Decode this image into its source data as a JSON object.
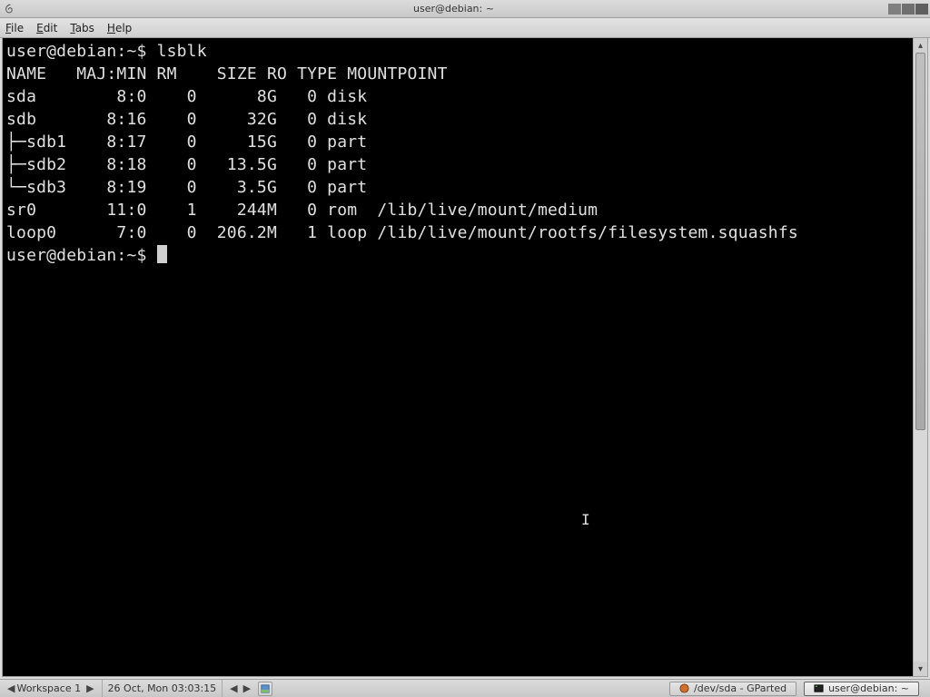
{
  "osbar": {
    "title": "user@debian: ~"
  },
  "menubar": {
    "file": {
      "letter": "F",
      "rest": "ile"
    },
    "edit": {
      "letter": "E",
      "rest": "dit"
    },
    "tabs": {
      "letter": "T",
      "rest": "abs"
    },
    "help": {
      "letter": "H",
      "rest": "elp"
    }
  },
  "terminal": {
    "prompt": "user@debian:~$ ",
    "command": "lsblk",
    "headers": [
      "NAME",
      "MAJ:MIN",
      "RM",
      "SIZE",
      "RO",
      "TYPE",
      "MOUNTPOINT"
    ],
    "rows": [
      {
        "name": "sda",
        "prefix": "",
        "majmin": "8:0",
        "rm": "0",
        "size": "8G",
        "ro": "0",
        "type": "disk",
        "mount": ""
      },
      {
        "name": "sdb",
        "prefix": "",
        "majmin": "8:16",
        "rm": "0",
        "size": "32G",
        "ro": "0",
        "type": "disk",
        "mount": ""
      },
      {
        "name": "sdb1",
        "prefix": "├─",
        "majmin": "8:17",
        "rm": "0",
        "size": "15G",
        "ro": "0",
        "type": "part",
        "mount": ""
      },
      {
        "name": "sdb2",
        "prefix": "├─",
        "majmin": "8:18",
        "rm": "0",
        "size": "13.5G",
        "ro": "0",
        "type": "part",
        "mount": ""
      },
      {
        "name": "sdb3",
        "prefix": "└─",
        "majmin": "8:19",
        "rm": "0",
        "size": "3.5G",
        "ro": "0",
        "type": "part",
        "mount": ""
      },
      {
        "name": "sr0",
        "prefix": "",
        "majmin": "11:0",
        "rm": "1",
        "size": "244M",
        "ro": "0",
        "type": "rom",
        "mount": "/lib/live/mount/medium"
      },
      {
        "name": "loop0",
        "prefix": "",
        "majmin": "7:0",
        "rm": "0",
        "size": "206.2M",
        "ro": "1",
        "type": "loop",
        "mount": "/lib/live/mount/rootfs/filesystem.squashfs"
      }
    ]
  },
  "taskbar": {
    "workspace": "Workspace 1",
    "clock": "26 Oct, Mon 03:03:15",
    "apps": {
      "gparted": "/dev/sda - GParted",
      "terminal": "user@debian: ~"
    }
  }
}
